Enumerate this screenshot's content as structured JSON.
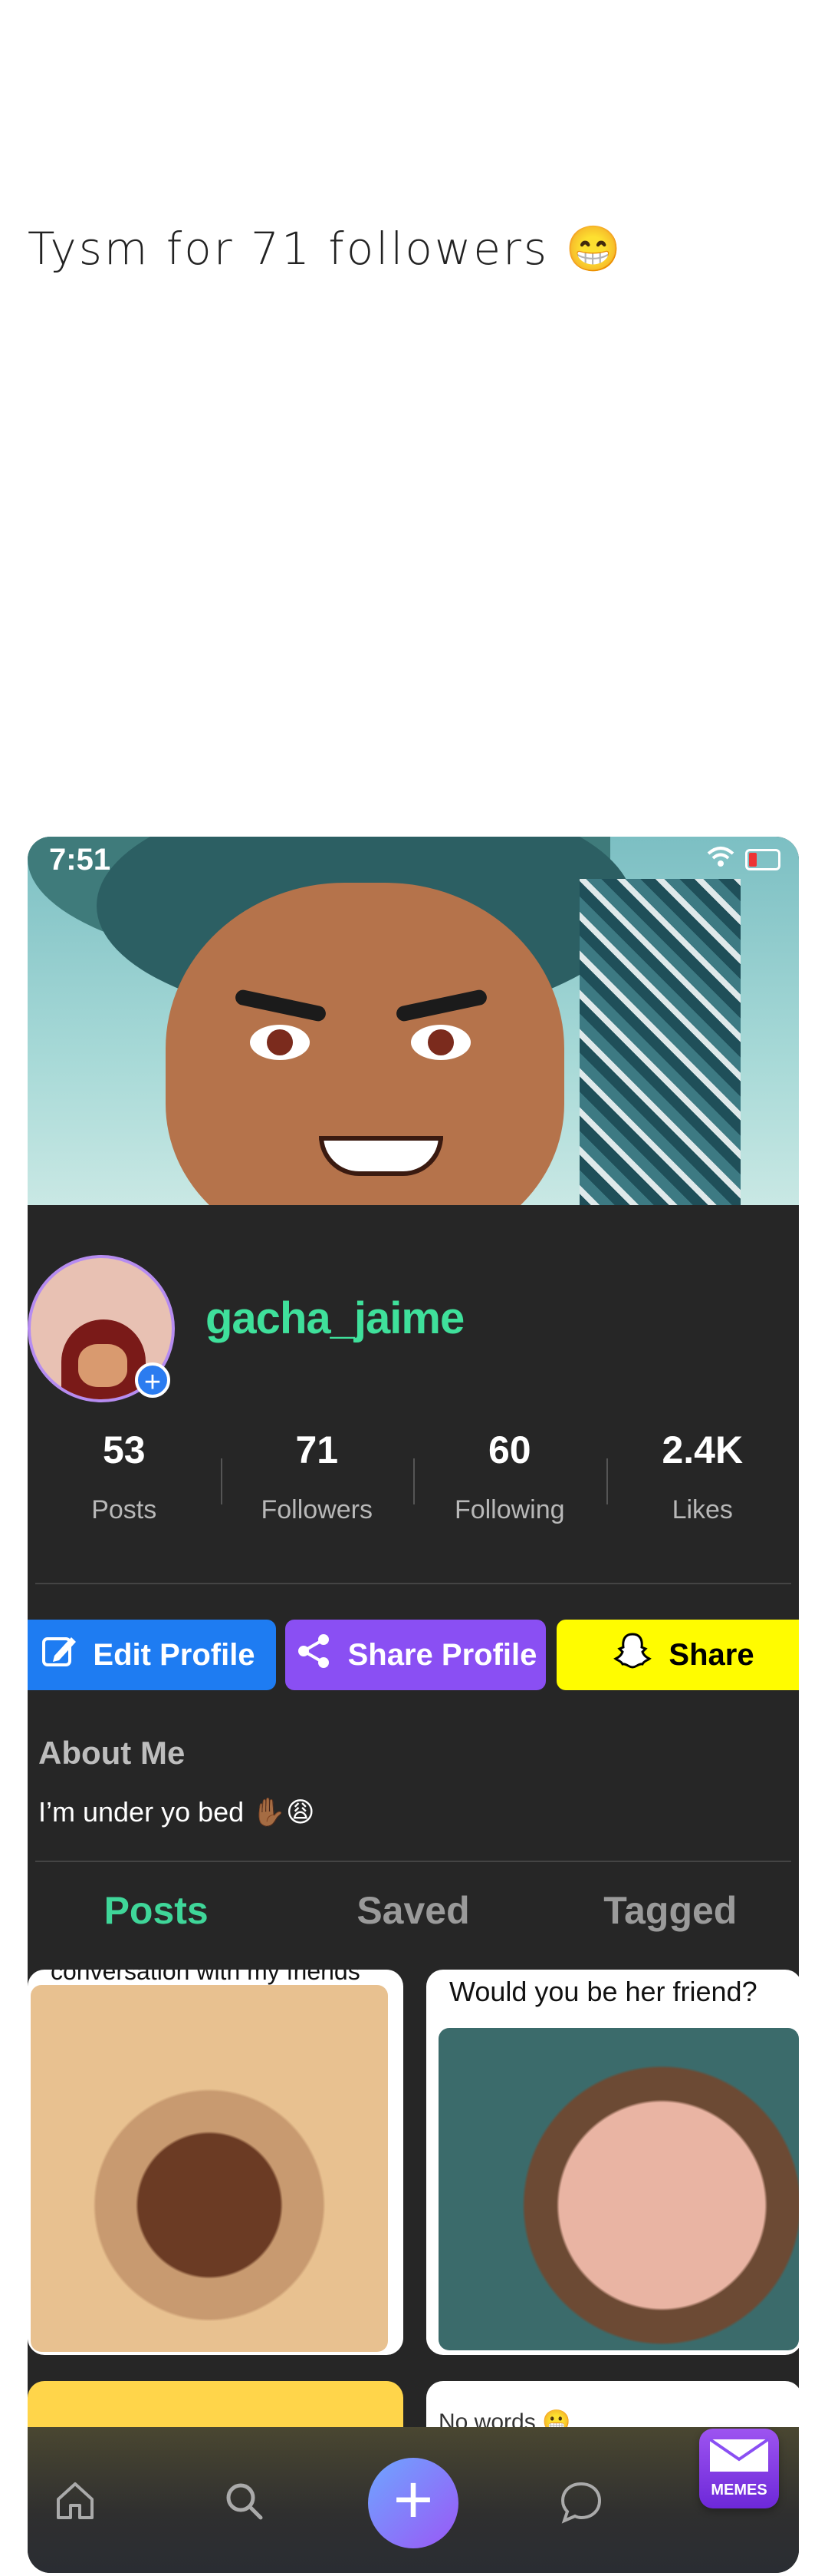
{
  "caption": "Tysm for 71 followers 😁",
  "status_bar": {
    "time": "7:51"
  },
  "profile": {
    "username": "gacha_jaime",
    "stats": [
      {
        "value": "53",
        "label": "Posts"
      },
      {
        "value": "71",
        "label": "Followers"
      },
      {
        "value": "60",
        "label": "Following"
      },
      {
        "value": "2.4K",
        "label": "Likes"
      }
    ]
  },
  "buttons": {
    "edit": "Edit Profile",
    "share_profile": "Share Profile",
    "share": "Share"
  },
  "about": {
    "title": "About Me",
    "text": "I’m under yo bed ✋🏾😩"
  },
  "tabs": [
    "Posts",
    "Saved",
    "Tagged"
  ],
  "posts": [
    {
      "caption": "conversation with my friends"
    },
    {
      "caption": "Would you be her friend?"
    },
    {
      "caption": ""
    },
    {
      "caption": "No words 😬"
    }
  ],
  "watermark": "MEMES",
  "colors": {
    "username": "#3fe09b",
    "active_tab": "#3fd699",
    "edit_button": "#1e7cf2",
    "share_profile_button": "#8a4ff3",
    "snap_button": "#fffc00"
  }
}
